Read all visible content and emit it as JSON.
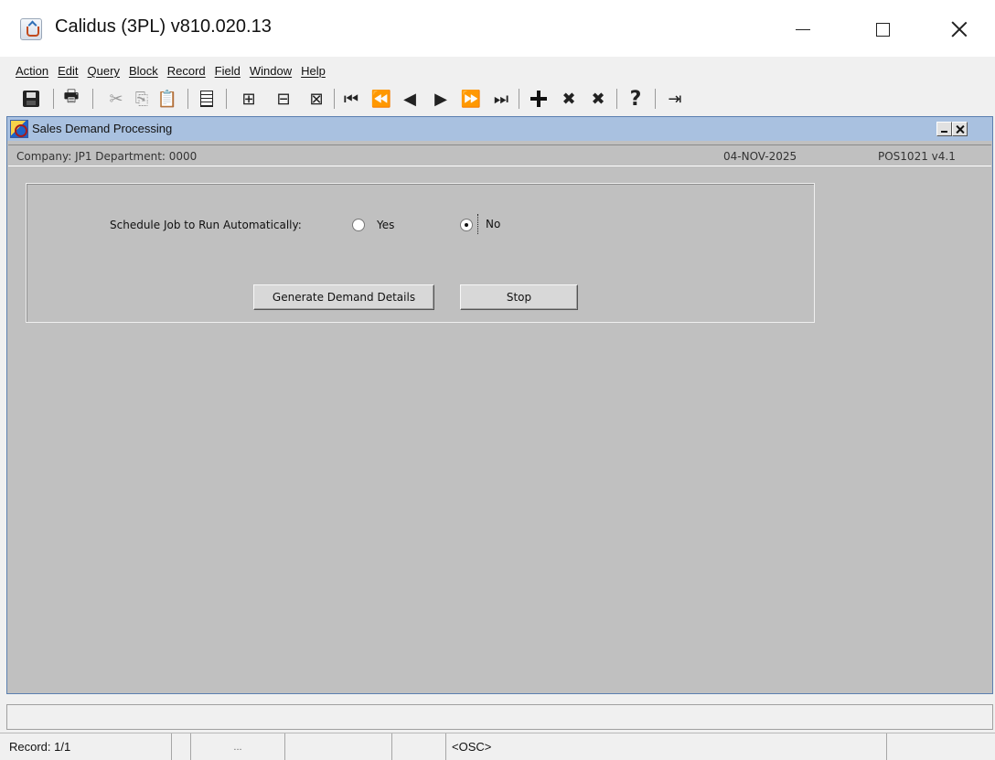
{
  "window": {
    "title": "Calidus (3PL) v810.020.13",
    "icons": [
      "java-app-icon",
      "minimize-icon",
      "maximize-icon",
      "close-icon"
    ]
  },
  "menu": {
    "items": [
      "Action",
      "Edit",
      "Query",
      "Block",
      "Record",
      "Field",
      "Window",
      "Help"
    ]
  },
  "toolbar": {
    "print": "🖶",
    "cut": "✂",
    "copy": "⎘",
    "paste": "📋",
    "enter_query": "⊞",
    "execute_query": "⊟",
    "cancel_query": "⊠",
    "first": "⏮",
    "prev_set": "⏪",
    "prev": "◀",
    "next": "▶",
    "next_set": "⏩",
    "last": "⏭",
    "delete": "✖",
    "help": "?",
    "exit": "⇥"
  },
  "form": {
    "title": "Sales Demand Processing",
    "context": {
      "company": "Company: JP1   Department: 0000",
      "date": "04-NOV-2025",
      "form_id": "POS1021 v4.1"
    },
    "schedule_label": "Schedule Job to Run Automatically:",
    "option_yes": "Yes",
    "option_no": "No",
    "selected": "No",
    "generate_button": "Generate Demand Details",
    "stop_button": "Stop"
  },
  "status": {
    "record": "Record: 1/1",
    "list_indicator": "...",
    "mode": "<OSC>"
  }
}
